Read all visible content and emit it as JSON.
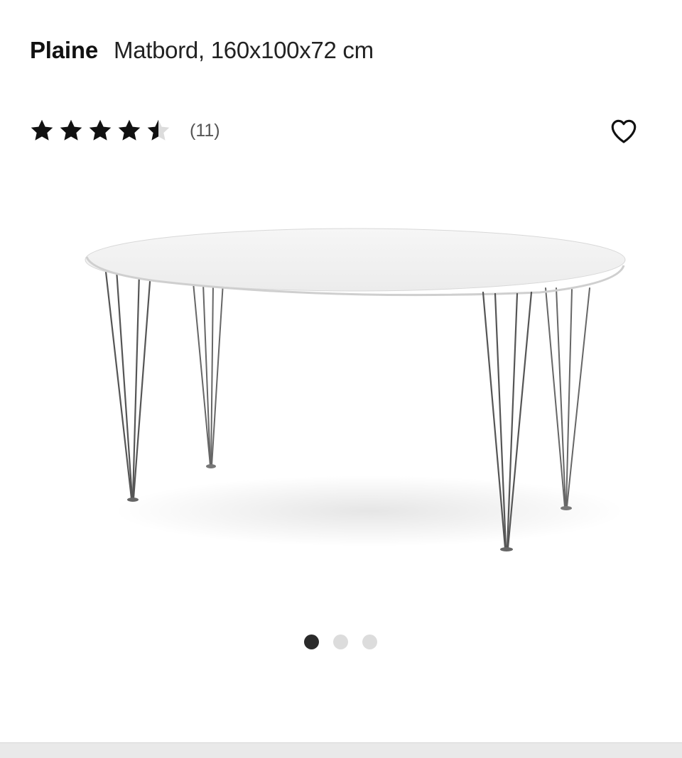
{
  "product": {
    "brand": "Plaine",
    "description": "Matbord, 160x100x72 cm"
  },
  "rating": {
    "value": 4.5,
    "max": 5,
    "count_label": "(11)",
    "star_color": "#111111",
    "empty_star_color": "#d9d9d9"
  },
  "favorite": {
    "icon": "heart-outline-icon"
  },
  "image": {
    "subject": "oval white dining table with chrome hairpin legs"
  },
  "carousel": {
    "total": 3,
    "active_index": 0,
    "active_color": "#2a2a2a",
    "inactive_color": "#dcdcdc"
  }
}
